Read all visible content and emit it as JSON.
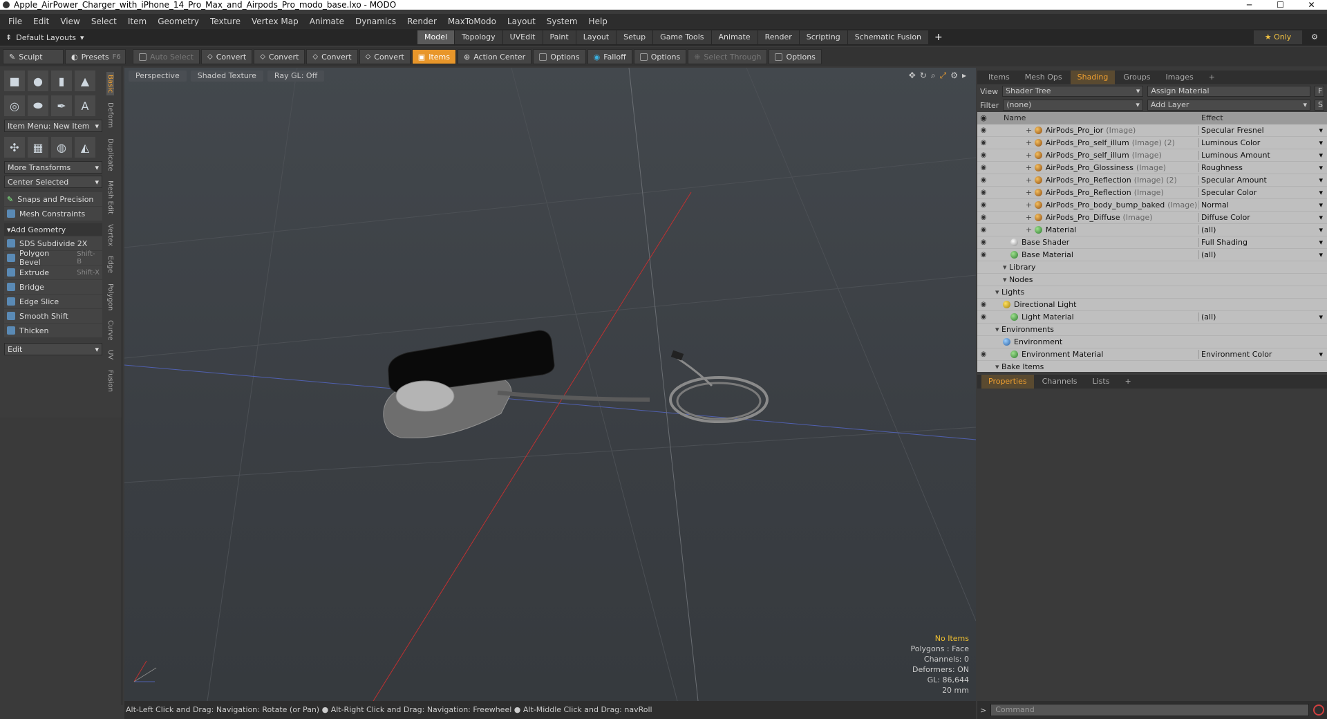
{
  "title": "Apple_AirPower_Charger_with_iPhone_14_Pro_Max_and_Airpods_Pro_modo_base.lxo - MODO",
  "window_controls": {
    "minimize": "─",
    "maximize": "☐",
    "close": "✕"
  },
  "menu": [
    "File",
    "Edit",
    "View",
    "Select",
    "Item",
    "Geometry",
    "Texture",
    "Vertex Map",
    "Animate",
    "Dynamics",
    "Render",
    "MaxToModo",
    "Layout",
    "System",
    "Help"
  ],
  "layout": {
    "name": "Default Layouts",
    "tabs": [
      "Model",
      "Topology",
      "UVEdit",
      "Paint",
      "Layout",
      "Setup",
      "Game Tools",
      "Animate",
      "Render",
      "Scripting",
      "Schematic Fusion"
    ],
    "active_tab": "Model",
    "add": "+",
    "only": "★ Only"
  },
  "toolbar": {
    "sculpt": "Sculpt",
    "presets": "Presets",
    "presets_key": "F6",
    "auto_select": "Auto Select",
    "convert1": "Convert",
    "convert2": "Convert",
    "convert3": "Convert",
    "convert4": "Convert",
    "items": "Items",
    "action_center": "Action Center",
    "options1": "Options",
    "falloff": "Falloff",
    "options2": "Options",
    "select_through": "Select Through",
    "options3": "Options"
  },
  "left": {
    "item_menu": "Item Menu: New Item",
    "more_transforms": "More Transforms",
    "center_selected": "Center Selected",
    "snaps": "Snaps and Precision",
    "mesh_constraints": "Mesh Constraints",
    "add_geometry": "Add Geometry",
    "tools": [
      {
        "label": "SDS Subdivide 2X",
        "key": ""
      },
      {
        "label": "Polygon Bevel",
        "key": "Shift-B"
      },
      {
        "label": "Extrude",
        "key": "Shift-X"
      },
      {
        "label": "Bridge",
        "key": ""
      },
      {
        "label": "Edge Slice",
        "key": ""
      },
      {
        "label": "Smooth Shift",
        "key": ""
      },
      {
        "label": "Thicken",
        "key": ""
      }
    ],
    "edit": "Edit",
    "vtabs": [
      "Basic",
      "Deform",
      "Duplicate",
      "Mesh Edit",
      "Vertex",
      "Edge",
      "Polygon",
      "Curve",
      "UV",
      "Fusion"
    ]
  },
  "viewport": {
    "perspective": "Perspective",
    "shading": "Shaded Texture",
    "raygl": "Ray GL: Off",
    "info": {
      "no_items": "No Items",
      "polygons": "Polygons : Face",
      "channels": "Channels: 0",
      "deformers": "Deformers: ON",
      "gl": "GL: 86,644",
      "scale": "20 mm"
    }
  },
  "status": "Alt-Left Click and Drag: Navigation: Rotate (or Pan) ● Alt-Right Click and Drag: Navigation: Freewheel ● Alt-Middle Click and Drag: navRoll",
  "right": {
    "tabs": [
      "Items",
      "Mesh Ops",
      "Shading",
      "Groups",
      "Images",
      "+"
    ],
    "active_tab": "Shading",
    "view_label": "View",
    "view_value": "Shader Tree",
    "assign_material": "Assign Material",
    "filter_label": "Filter",
    "filter_value": "(none)",
    "add_layer": "Add Layer",
    "col_name": "Name",
    "col_effect": "Effect",
    "rows": [
      {
        "name": "AirPods_Pro_ior",
        "sub": "(Image)",
        "effect": "Specular Fresnel",
        "indent": 4,
        "icon": "img",
        "eye": true
      },
      {
        "name": "AirPods_Pro_self_illum",
        "sub": "(Image) (2)",
        "effect": "Luminous Color",
        "indent": 4,
        "icon": "img",
        "eye": true
      },
      {
        "name": "AirPods_Pro_self_illum",
        "sub": "(Image)",
        "effect": "Luminous Amount",
        "indent": 4,
        "icon": "img",
        "eye": true
      },
      {
        "name": "AirPods_Pro_Glossiness",
        "sub": "(Image)",
        "effect": "Roughness",
        "indent": 4,
        "icon": "img",
        "eye": true
      },
      {
        "name": "AirPods_Pro_Reflection",
        "sub": "(Image) (2)",
        "effect": "Specular Amount",
        "indent": 4,
        "icon": "img",
        "eye": true
      },
      {
        "name": "AirPods_Pro_Reflection",
        "sub": "(Image)",
        "effect": "Specular Color",
        "indent": 4,
        "icon": "img",
        "eye": true
      },
      {
        "name": "AirPods_Pro_body_bump_baked",
        "sub": "(Image)",
        "effect": "Normal",
        "indent": 4,
        "icon": "img",
        "eye": true
      },
      {
        "name": "AirPods_Pro_Diffuse",
        "sub": "(Image)",
        "effect": "Diffuse Color",
        "indent": 4,
        "icon": "img",
        "eye": true
      },
      {
        "name": "Material",
        "sub": "",
        "effect": "(all)",
        "indent": 4,
        "icon": "mat",
        "eye": true
      },
      {
        "name": "Base Shader",
        "sub": "",
        "effect": "Full Shading",
        "indent": 2,
        "icon": "shd",
        "eye": true
      },
      {
        "name": "Base Material",
        "sub": "",
        "effect": "(all)",
        "indent": 2,
        "icon": "mat",
        "eye": true
      },
      {
        "name": "Library",
        "sub": "",
        "effect": "",
        "indent": 1,
        "icon": "",
        "eye": false
      },
      {
        "name": "Nodes",
        "sub": "",
        "effect": "",
        "indent": 1,
        "icon": "",
        "eye": false
      },
      {
        "name": "Lights",
        "sub": "",
        "effect": "",
        "indent": 0,
        "icon": "",
        "eye": false
      },
      {
        "name": "Directional Light",
        "sub": "",
        "effect": "",
        "indent": 1,
        "icon": "lgt",
        "eye": true
      },
      {
        "name": "Light Material",
        "sub": "",
        "effect": "(all)",
        "indent": 2,
        "icon": "mat",
        "eye": true
      },
      {
        "name": "Environments",
        "sub": "",
        "effect": "",
        "indent": 0,
        "icon": "",
        "eye": false
      },
      {
        "name": "Environment",
        "sub": "",
        "effect": "",
        "indent": 1,
        "icon": "env",
        "eye": false
      },
      {
        "name": "Environment Material",
        "sub": "",
        "effect": "Environment Color",
        "indent": 2,
        "icon": "mat",
        "eye": true
      },
      {
        "name": "Bake Items",
        "sub": "",
        "effect": "",
        "indent": 0,
        "icon": "",
        "eye": false
      }
    ],
    "props_tabs": [
      "Properties",
      "Channels",
      "Lists",
      "+"
    ],
    "command_placeholder": "Command"
  }
}
